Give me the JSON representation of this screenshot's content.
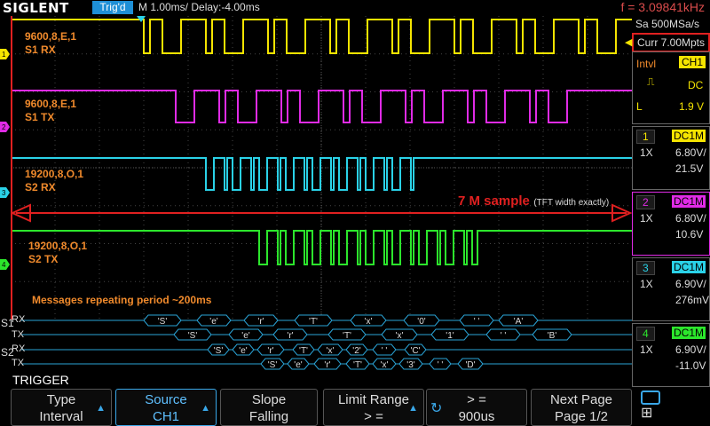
{
  "topbar": {
    "brand": "SIGLENT",
    "trigger_state": "Trig'd",
    "timebase": "M 1.00ms/ Delay:-4.00ms",
    "frequency": "f = 3.09841kHz"
  },
  "channels": [
    {
      "num": "1",
      "color": "#f5e400",
      "label1": "9600,8,E,1",
      "label2": "S1 RX"
    },
    {
      "num": "2",
      "color": "#e02be6",
      "label1": "9600,8,E,1",
      "label2": "S1 TX"
    },
    {
      "num": "3",
      "color": "#2ad2e8",
      "label1": "19200,8,O,1",
      "label2": "S2 RX"
    },
    {
      "num": "4",
      "color": "#2ce62c",
      "label1": "19200,8,O,1",
      "label2": "S2 TX"
    }
  ],
  "annotation": {
    "sample_main": "7 M sample",
    "sample_note": "(TFT width exactly)",
    "period": "Messages repeating period ~200ms"
  },
  "acquisition": {
    "sample_rate": "Sa 500MSa/s",
    "memory": "Curr 7.00Mpts"
  },
  "trigger_info": {
    "type": "Intvl",
    "source": "CH1",
    "coupling": "DC",
    "level_label": "L",
    "level": "1.9 V"
  },
  "channel_info": [
    {
      "num": "1",
      "coupling": "DC1M",
      "probe": "1X",
      "scale": "6.80V/",
      "offset": "21.5V"
    },
    {
      "num": "2",
      "coupling": "DC1M",
      "probe": "1X",
      "scale": "6.80V/",
      "offset": "10.6V"
    },
    {
      "num": "3",
      "coupling": "DC1M",
      "probe": "1X",
      "scale": "6.90V/",
      "offset": "276mV"
    },
    {
      "num": "4",
      "coupling": "DC1M",
      "probe": "1X",
      "scale": "6.90V/",
      "offset": "-11.0V"
    }
  ],
  "decode": {
    "s1_label": "S1",
    "s2_label": "S2",
    "rx": "RX",
    "tx": "TX",
    "s1_rx": [
      "'S'",
      "'e'",
      "'r'",
      "'T'",
      "'x'",
      "'0'",
      "' '",
      "'A'"
    ],
    "s1_tx": [
      "'S'",
      "'e'",
      "'r'",
      "'T'",
      "'x'",
      "'1'",
      "' '",
      "'B'"
    ],
    "s2_rx": [
      "'S'",
      "'e'",
      "'r'",
      "'T'",
      "'x'",
      "'2'",
      "' '",
      "'C'"
    ],
    "s2_tx": [
      "'S'",
      "'e'",
      "'r'",
      "'T'",
      "'x'",
      "'3'",
      "' '",
      "'D'"
    ]
  },
  "menu": {
    "title": "TRIGGER",
    "softkeys": [
      {
        "top": "Type",
        "bottom": "Interval"
      },
      {
        "top": "Source",
        "bottom": "CH1"
      },
      {
        "top": "Slope",
        "bottom": "Falling"
      },
      {
        "top": "Limit Range",
        "bottom": "> ="
      },
      {
        "top": "> =",
        "bottom": "900us"
      },
      {
        "top": "Next Page",
        "bottom": "Page 1/2"
      }
    ]
  },
  "colors": {
    "ch1": "#f5e400",
    "ch2": "#e02be6",
    "ch3": "#2ad2e8",
    "ch4": "#2ce62c",
    "annotation": "#f08a2c",
    "accent": "#1e8fd6",
    "red": "#e02020"
  }
}
